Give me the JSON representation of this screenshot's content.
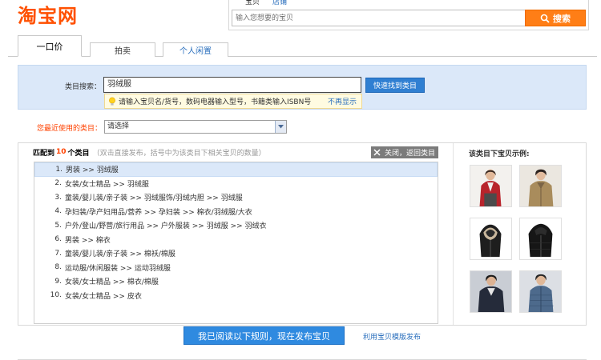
{
  "header": {
    "logo_text": "淘宝网",
    "search_tabs": [
      "宝贝",
      "店铺"
    ],
    "search_placeholder": "输入您想要的宝贝",
    "search_button": "搜索"
  },
  "tabs": [
    "一口价",
    "拍卖",
    "个人闲置"
  ],
  "category_search": {
    "label": "类目搜索：",
    "value": "羽绒服",
    "button": "快速找到类目",
    "hint": "请输入宝贝名/货号，数码电器输入型号，书籍类输入ISBN号",
    "hint_close": "不再显示"
  },
  "recent": {
    "label": "您最近使用的类目：",
    "selected": "请选择"
  },
  "results": {
    "match_prefix": "匹配到",
    "match_count": "10",
    "match_suffix": "个类目",
    "match_note": "（双击直接发布，括号中为该类目下相关宝贝的数量）",
    "close_button": "关闭，返回类目",
    "items": [
      {
        "idx": "1.",
        "text": "男装 >> 羽绒服",
        "selected": true
      },
      {
        "idx": "2.",
        "text": "女装/女士精品 >> 羽绒服"
      },
      {
        "idx": "3.",
        "text": "童装/婴儿装/亲子装 >> 羽绒服饰/羽绒内胆 >> 羽绒服"
      },
      {
        "idx": "4.",
        "text": "孕妇装/孕产妇用品/营养 >> 孕妇装 >> 棉衣/羽绒服/大衣"
      },
      {
        "idx": "5.",
        "text": "户外/登山/野营/旅行用品 >> 户外服装 >> 羽绒服 >> 羽绒衣"
      },
      {
        "idx": "6.",
        "text": "男装 >> 棉衣"
      },
      {
        "idx": "7.",
        "text": "童装/婴儿装/亲子装 >> 棉袄/棉服"
      },
      {
        "idx": "8.",
        "text": "运动服/休闲服装 >> 运动羽绒服"
      },
      {
        "idx": "9.",
        "text": "女装/女士精品 >> 棉衣/棉服"
      },
      {
        "idx": "10.",
        "text": "女装/女士精品 >> 皮衣"
      }
    ]
  },
  "examples": {
    "title": "该类目下宝贝示例:",
    "images": [
      "red-jacket-model",
      "khaki-jacket-model",
      "black-fur-hood-jacket",
      "black-hooded-puffer",
      "navy-coat-model",
      "blue-quilted-jacket-model"
    ]
  },
  "footer": {
    "publish_button": "我已阅读以下规则，现在发布宝贝",
    "template_link": "利用宝贝模版发布"
  },
  "colors": {
    "brand": "#ff5000",
    "accent_blue": "#2f8ae0",
    "panel_bg": "#dbe8f9",
    "warning": "#ff4200"
  }
}
